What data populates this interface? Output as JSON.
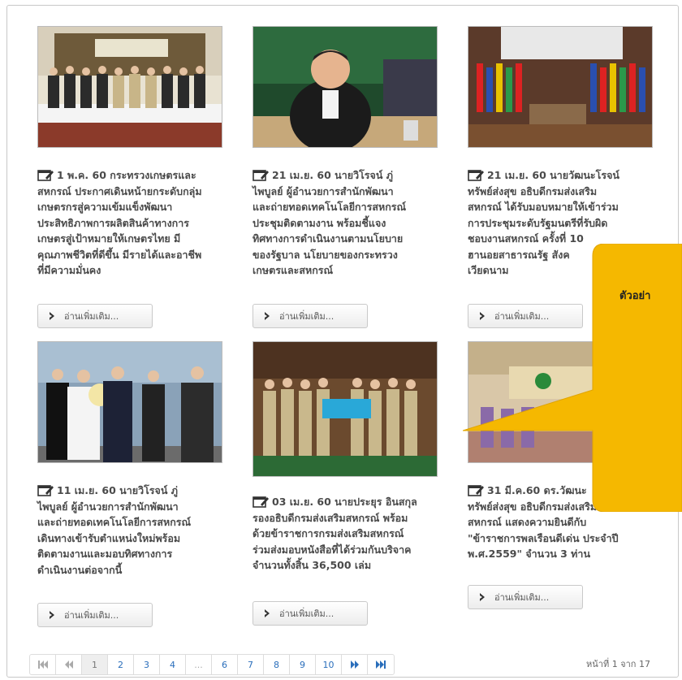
{
  "news": [
    {
      "date": "1 พ.ค. 60",
      "lines": [
        "1 พ.ค. 60 กระทรวงเกษตรและ",
        "สหกรณ์ ประกาศเดินหน้ายกระดับกลุ่ม",
        "เกษตรกรสู่ความเข้มแข็งพัฒนา",
        "ประสิทธิภาพการผลิตสินค้าทางการ",
        "เกษตรสู่เป้าหมายให้เกษตรไทย มี",
        "คุณภาพชีวิตที่ดีขึ้น มีรายได้และอาชีพ",
        "ที่มีความมั่นคง"
      ],
      "button": "อ่านเพิ่มเติม..."
    },
    {
      "date": "21 เม.ย. 60",
      "lines": [
        "21 เม.ย. 60 นายวิโรจน์ ภู่",
        "ไพบูลย์ ผู้อำนวยการสำนักพัฒนา",
        "และถ่ายทอดเทคโนโลยีการสหกรณ์",
        "ประชุมติดตามงาน พร้อมชี้แจง",
        "ทิศทางการดำเนินงานตามนโยบาย",
        "ของรัฐบาล นโยบายของกระทรวง",
        "เกษตรและสหกรณ์"
      ],
      "button": "อ่านเพิ่มเติม..."
    },
    {
      "date": "21 เม.ย. 60",
      "lines": [
        "21 เม.ย. 60 นายวัฒนะโรจน์",
        "ทรัพย์ส่งสุข อธิบดีกรมส่งเสริม",
        "สหกรณ์ ได้รับมอบหมายให้เข้าร่วม",
        "การประชุมระดับรัฐมนตรีที่รับผิด",
        "ชอบงานสหกรณ์ ครั้งที่ 10",
        "ฮานอยสาธารณรัฐ สังค",
        "เวียดนาม"
      ],
      "button": "อ่านเพิ่มเติม..."
    },
    {
      "date": "11 เม.ย. 60",
      "lines": [
        "11 เม.ย. 60 นายวิโรจน์ ภู่",
        "ไพบูลย์ ผู้อำนวยการสำนักพัฒนา",
        "และถ่ายทอดเทคโนโลยีการสหกรณ์",
        "เดินทางเข้ารับตำแหน่งใหม่พร้อม",
        "ติดตามงานและมอบทิศทางการ",
        "ดำเนินงานต่อจากนี้"
      ],
      "button": "อ่านเพิ่มเติม..."
    },
    {
      "date": "03 เม.ย. 60",
      "lines": [
        "03 เม.ย. 60 นายประยุร อินสกุล",
        "รองอธิบดีกรมส่งเสริมสหกรณ์ พร้อม",
        "ด้วยข้าราชการกรมส่งเสริมสหกรณ์",
        "ร่วมส่งมอบหนังสือที่ได้ร่วมกันบริจาค",
        "จำนวนทั้งสิ้น 36,500 เล่ม"
      ],
      "button": "อ่านเพิ่มเติม..."
    },
    {
      "date": "31 มี.ค.60",
      "lines": [
        "31 มี.ค.60 ดร.วัฒนะ",
        "ทรัพย์ส่งสุข อธิบดีกรมส่งเสริม",
        "สหกรณ์ แสดงความยินดีกับ",
        "\"ข้าราชการพลเรือนดีเด่น ประจำปี",
        "พ.ศ.2559\" จำนวน 3 ท่าน"
      ],
      "button": "อ่านเพิ่มเติม..."
    }
  ],
  "pagination": {
    "first_icon": "first-page-icon",
    "prev_icon": "prev-page-icon",
    "pages": [
      "1",
      "2",
      "3",
      "4",
      "...",
      "6",
      "7",
      "8",
      "9",
      "10"
    ],
    "current": "1",
    "next_icon": "next-page-icon",
    "last_icon": "last-page-icon",
    "info": "หน้าที่ 1 จาก 17"
  },
  "callout": {
    "text": "ตัวอย่า",
    "color": "#f5b800"
  },
  "colors": {
    "link": "#2a6ebb",
    "text": "#4a4a4a"
  }
}
